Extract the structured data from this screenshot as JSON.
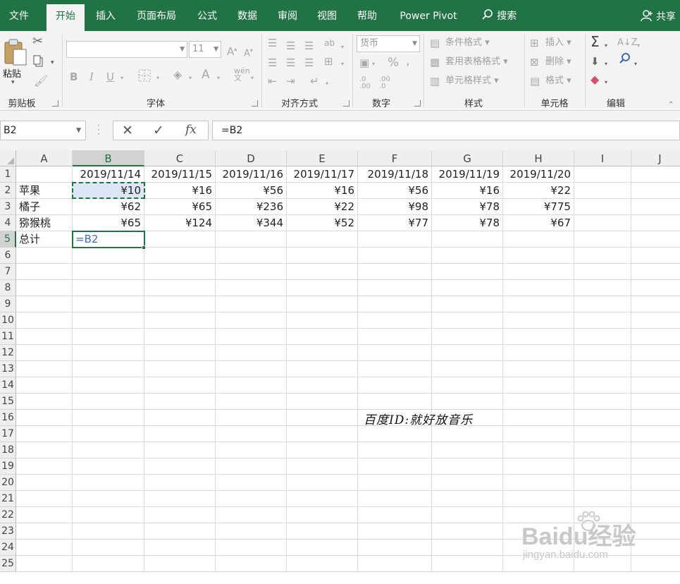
{
  "menu": {
    "tabs": [
      "文件",
      "开始",
      "插入",
      "页面布局",
      "公式",
      "数据",
      "审阅",
      "视图",
      "帮助",
      "Power Pivot"
    ],
    "active_tab": "开始",
    "search_label": "搜索",
    "share_label": "共享"
  },
  "ribbon": {
    "clipboard": {
      "label": "剪贴板",
      "paste_label": "粘贴"
    },
    "font": {
      "label": "字体",
      "font_name": "",
      "font_size": "11"
    },
    "alignment": {
      "label": "对齐方式"
    },
    "number": {
      "label": "数字",
      "format": "货币"
    },
    "styles": {
      "label": "样式",
      "conditional_format": "条件格式",
      "format_as_table": "套用表格格式",
      "cell_styles": "单元格样式"
    },
    "cells": {
      "label": "单元格",
      "insert": "插入",
      "delete": "删除",
      "format": "格式"
    },
    "editing": {
      "label": "编辑"
    }
  },
  "formula_bar": {
    "name_box": "B2",
    "formula": "=B2",
    "fx_label": "fx"
  },
  "sheet": {
    "columns": [
      "A",
      "B",
      "C",
      "D",
      "E",
      "F",
      "G",
      "H",
      "I",
      "J"
    ],
    "rows": [
      "1",
      "2",
      "3",
      "4",
      "5",
      "6",
      "7",
      "8",
      "9",
      "10",
      "11",
      "12",
      "13",
      "14",
      "15",
      "16",
      "17",
      "18",
      "19",
      "20",
      "21",
      "22",
      "23",
      "24",
      "25"
    ],
    "selected_column": "B",
    "selected_row": "5",
    "cells": {
      "B1": "2019/11/14",
      "C1": "2019/11/15",
      "D1": "2019/11/16",
      "E1": "2019/11/17",
      "F1": "2019/11/18",
      "G1": "2019/11/19",
      "H1": "2019/11/20",
      "A2": "苹果",
      "B2": "¥10",
      "C2": "¥16",
      "D2": "¥56",
      "E2": "¥16",
      "F2": "¥56",
      "G2": "¥16",
      "H2": "¥22",
      "A3": "橘子",
      "B3": "¥62",
      "C3": "¥65",
      "D3": "¥236",
      "E3": "¥22",
      "F3": "¥98",
      "G3": "¥78",
      "H3": "¥775",
      "A4": "猕猴桃",
      "B4": "¥65",
      "C4": "¥124",
      "D4": "¥344",
      "E4": "¥52",
      "F4": "¥77",
      "G4": "¥78",
      "H4": "¥67",
      "A5": "总计",
      "B5": "=B2"
    }
  },
  "overlay": {
    "signature": "百度ID:就好放音乐",
    "watermark_main": "Baidu经验",
    "watermark_sub": "jingyan.baidu.com"
  },
  "colors": {
    "excel_green": "#217346",
    "formula_ref_blue": "#3a6fc4",
    "copy_fill": "#dce6f4"
  }
}
